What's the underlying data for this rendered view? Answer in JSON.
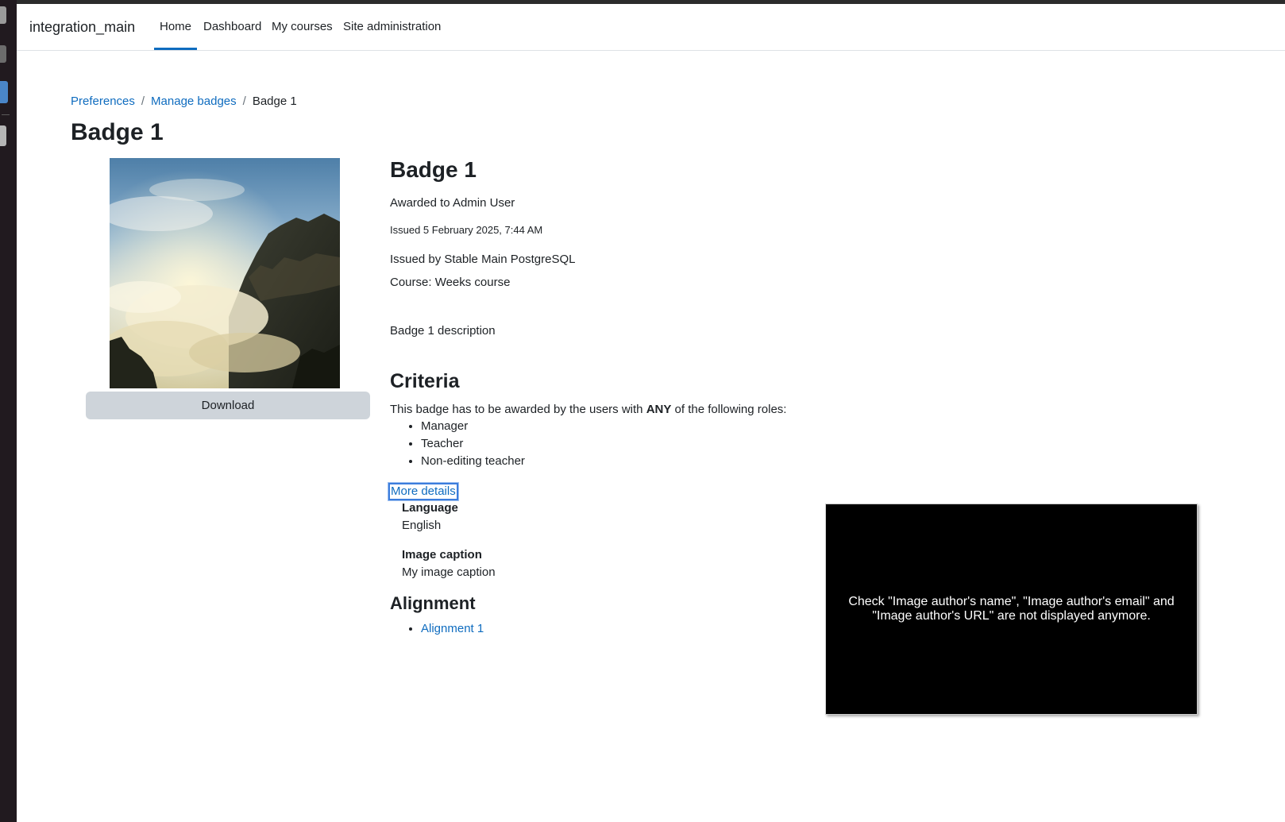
{
  "navbar": {
    "brand": "integration_main",
    "items": [
      {
        "label": "Home",
        "active": true
      },
      {
        "label": "Dashboard",
        "active": false
      },
      {
        "label": "My courses",
        "active": false
      },
      {
        "label": "Site administration",
        "active": false
      }
    ]
  },
  "breadcrumb": {
    "items": [
      "Preferences",
      "Manage badges"
    ],
    "current": "Badge 1"
  },
  "page_title": "Badge 1",
  "badge": {
    "download_label": "Download",
    "name": "Badge 1",
    "awarded_to": "Awarded to Admin User",
    "issued_on": "Issued 5 February 2025, 7:44 AM",
    "issued_by": "Issued by Stable Main PostgreSQL",
    "course": "Course: Weeks course",
    "description": "Badge 1 description"
  },
  "criteria": {
    "heading": "Criteria",
    "intro_prefix": "This badge has to be awarded by the users with ",
    "intro_emphasis": "ANY",
    "intro_suffix": " of the following roles:",
    "roles": [
      "Manager",
      "Teacher",
      "Non-editing teacher"
    ]
  },
  "more_details": {
    "link_label": "More details",
    "fields": [
      {
        "label": "Language",
        "value": "English"
      },
      {
        "label": "Image caption",
        "value": "My image caption"
      }
    ]
  },
  "alignment": {
    "heading": "Alignment",
    "items": [
      "Alignment 1"
    ]
  },
  "overlay_note": "Check \"Image author's name\", \"Image author's email\" and \"Image author's URL\" are not displayed anymore.",
  "colors": {
    "link": "#0f6cbf",
    "text": "#1d2125",
    "button_bg": "#ced4da",
    "dock_bg": "#211a1f"
  }
}
